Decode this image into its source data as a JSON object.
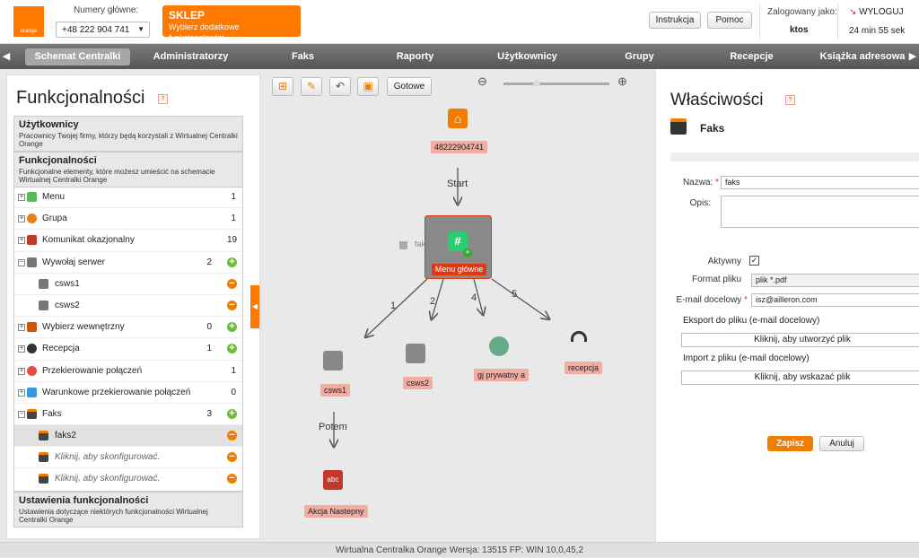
{
  "header": {
    "logo_text": "orange",
    "numbers_label": "Numery główne:",
    "number_selected": "+48 222 904 741",
    "shop_title": "SKLEP",
    "shop_subtitle": "Wybierz dodatkowe funkcjonalności",
    "instrukcja": "Instrukcja",
    "pomoc": "Pomoc",
    "logged_label": "Zalogowany jako:",
    "user": "ktos",
    "logout": "WYLOGUJ",
    "session_time": "24 min 55 sek"
  },
  "nav": {
    "tabs": [
      "Schemat Centralki",
      "Administratorzy",
      "Faks",
      "Raporty",
      "Użytkownicy",
      "Grupy",
      "Recepcje",
      "Książka adresowa"
    ]
  },
  "left": {
    "title": "Funkcjonalności",
    "help": "?",
    "users_title": "Użytkownicy",
    "users_desc": "Pracownicy Twojej firmy, którzy będą korzystali z Wirtualnej Centralki Orange",
    "func_title": "Funkcjonalności",
    "func_desc": "Funkcjonalne elementy, które możesz umieścić na schemacie Wirtualnej Centralki Orange",
    "items": [
      {
        "label": "Menu",
        "count": "1"
      },
      {
        "label": "Grupa",
        "count": "1"
      },
      {
        "label": "Komunikat okazjonalny",
        "count": "19"
      },
      {
        "label": "Wywołaj serwer",
        "count": "2"
      },
      {
        "label": "csws1"
      },
      {
        "label": "csws2"
      },
      {
        "label": "Wybierz wewnętrzny",
        "count": "0"
      },
      {
        "label": "Recepcja",
        "count": "1"
      },
      {
        "label": "Przekierowanie połączeń",
        "count": "1"
      },
      {
        "label": "Warunkowe przekierowanie połączeń",
        "count": "0"
      },
      {
        "label": "Faks",
        "count": "3"
      },
      {
        "label": "faks2"
      },
      {
        "label": "Kliknij, aby skonfigurować."
      },
      {
        "label": "Kliknij, aby skonfigurować."
      }
    ],
    "settings_title": "Ustawienia funkcjonalności",
    "settings_desc": "Ustawienia dotyczące niektórych funkcjonalności Wirtualnej Centralki Orange"
  },
  "canvas": {
    "done_button": "Gotowe",
    "start_number": "48222904741",
    "start_label": "Start",
    "menu_label": "Menu główne",
    "ghost_label": "faks2",
    "edges": [
      "1",
      "2",
      "4",
      "5"
    ],
    "nodes": [
      "csws1",
      "csws2",
      "gj prywatny a",
      "recepcja"
    ],
    "then_label": "Potem",
    "action_label": "Akcja Nastepny",
    "action_icon_text": "abc"
  },
  "right": {
    "title": "Właściwości",
    "help": "?",
    "section": "Faks",
    "name_label": "Nazwa:",
    "name_value": "faks",
    "desc_label": "Opis:",
    "active_label": "Aktywny",
    "active_check": "✓",
    "format_label": "Format pliku",
    "format_value": "plik *.pdf",
    "email_label": "E-mail docelowy",
    "email_value": "isz@ailleron.com",
    "export_label": "Eksport do pliku (e-mail docelowy)",
    "export_button": "Kliknij, aby utworzyć plik",
    "import_label": "Import z pliku (e-mail docelowy)",
    "import_button": "Kliknij, aby wskazać plik",
    "save": "Zapisz",
    "cancel": "Anuluj"
  },
  "status": "Wirtualna Centralka Orange Wersja: 13515    FP: WIN 10,0,45,2"
}
